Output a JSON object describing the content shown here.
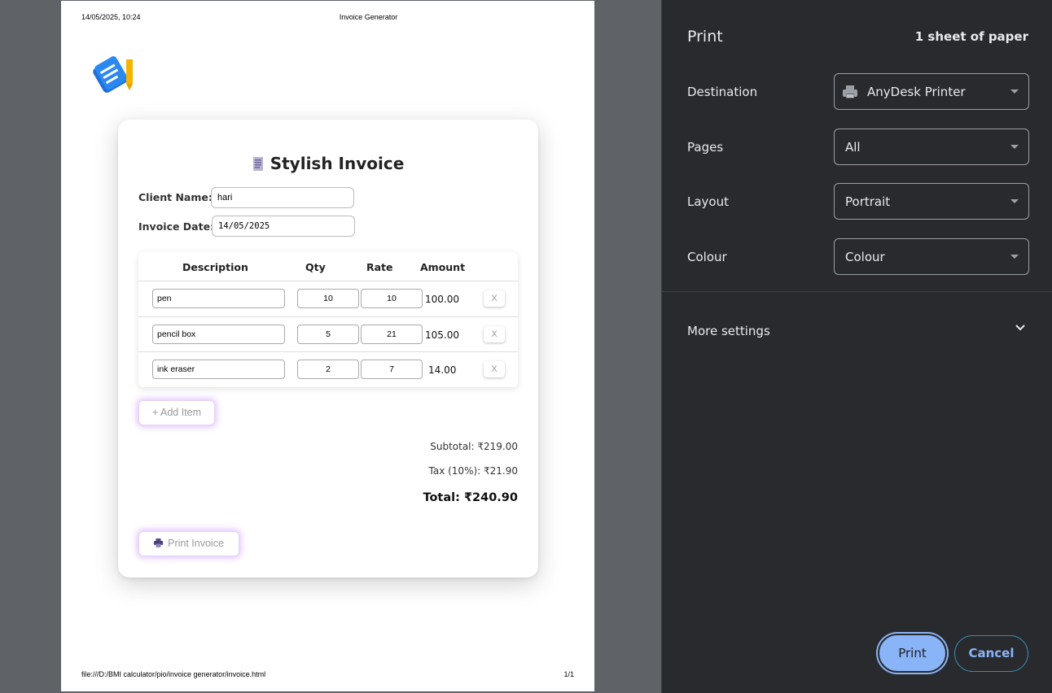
{
  "sheet": {
    "header_date": "14/05/2025, 10:24",
    "header_title": "Invoice Generator",
    "footer_url": "file:///D:/BMI calculator/pio/invoice generator/invoice.html",
    "footer_page": "1/1"
  },
  "invoice": {
    "title": "Stylish Invoice",
    "title_icon": "receipt-icon",
    "client_label": "Client Name:",
    "client_value": "hari",
    "date_label": "Invoice Date:",
    "date_value": "14/05/2025",
    "columns": [
      "Description",
      "Qty",
      "Rate",
      "Amount"
    ],
    "items": [
      {
        "description": "pen",
        "qty": "10",
        "rate": "10",
        "amount": "100.00",
        "remove": "X"
      },
      {
        "description": "pencil box",
        "qty": "5",
        "rate": "21",
        "amount": "105.00",
        "remove": "X"
      },
      {
        "description": "ink eraser",
        "qty": "2",
        "rate": "7",
        "amount": "14.00",
        "remove": "X"
      }
    ],
    "add_item_label": "+ Add Item",
    "subtotal": "Subtotal: ₹219.00",
    "tax": "Tax (10%): ₹21.90",
    "total": "Total: ₹240.90",
    "print_label": "Print Invoice"
  },
  "print_panel": {
    "title": "Print",
    "sheet_count": "1 sheet of paper",
    "destination_label": "Destination",
    "destination_value": "AnyDesk Printer",
    "pages_label": "Pages",
    "pages_value": "All",
    "layout_label": "Layout",
    "layout_value": "Portrait",
    "colour_label": "Colour",
    "colour_value": "Colour",
    "more_settings": "More settings",
    "print_button": "Print",
    "cancel_button": "Cancel"
  },
  "colors": {
    "panel_bg": "#292a2d",
    "accent": "#8ab4f8",
    "preview_bg": "#5f6368",
    "glow": "#be78ff"
  }
}
